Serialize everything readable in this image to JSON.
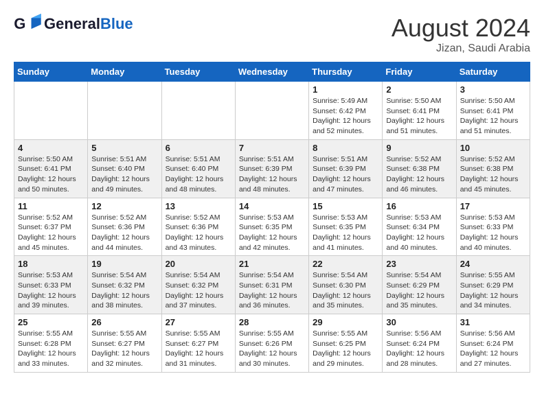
{
  "header": {
    "logo_general": "General",
    "logo_blue": "Blue",
    "month": "August 2024",
    "location": "Jizan, Saudi Arabia"
  },
  "days_of_week": [
    "Sunday",
    "Monday",
    "Tuesday",
    "Wednesday",
    "Thursday",
    "Friday",
    "Saturday"
  ],
  "weeks": [
    [
      {
        "day": "",
        "info": ""
      },
      {
        "day": "",
        "info": ""
      },
      {
        "day": "",
        "info": ""
      },
      {
        "day": "",
        "info": ""
      },
      {
        "day": "1",
        "info": "Sunrise: 5:49 AM\nSunset: 6:42 PM\nDaylight: 12 hours\nand 52 minutes."
      },
      {
        "day": "2",
        "info": "Sunrise: 5:50 AM\nSunset: 6:41 PM\nDaylight: 12 hours\nand 51 minutes."
      },
      {
        "day": "3",
        "info": "Sunrise: 5:50 AM\nSunset: 6:41 PM\nDaylight: 12 hours\nand 51 minutes."
      }
    ],
    [
      {
        "day": "4",
        "info": "Sunrise: 5:50 AM\nSunset: 6:41 PM\nDaylight: 12 hours\nand 50 minutes."
      },
      {
        "day": "5",
        "info": "Sunrise: 5:51 AM\nSunset: 6:40 PM\nDaylight: 12 hours\nand 49 minutes."
      },
      {
        "day": "6",
        "info": "Sunrise: 5:51 AM\nSunset: 6:40 PM\nDaylight: 12 hours\nand 48 minutes."
      },
      {
        "day": "7",
        "info": "Sunrise: 5:51 AM\nSunset: 6:39 PM\nDaylight: 12 hours\nand 48 minutes."
      },
      {
        "day": "8",
        "info": "Sunrise: 5:51 AM\nSunset: 6:39 PM\nDaylight: 12 hours\nand 47 minutes."
      },
      {
        "day": "9",
        "info": "Sunrise: 5:52 AM\nSunset: 6:38 PM\nDaylight: 12 hours\nand 46 minutes."
      },
      {
        "day": "10",
        "info": "Sunrise: 5:52 AM\nSunset: 6:38 PM\nDaylight: 12 hours\nand 45 minutes."
      }
    ],
    [
      {
        "day": "11",
        "info": "Sunrise: 5:52 AM\nSunset: 6:37 PM\nDaylight: 12 hours\nand 45 minutes."
      },
      {
        "day": "12",
        "info": "Sunrise: 5:52 AM\nSunset: 6:36 PM\nDaylight: 12 hours\nand 44 minutes."
      },
      {
        "day": "13",
        "info": "Sunrise: 5:52 AM\nSunset: 6:36 PM\nDaylight: 12 hours\nand 43 minutes."
      },
      {
        "day": "14",
        "info": "Sunrise: 5:53 AM\nSunset: 6:35 PM\nDaylight: 12 hours\nand 42 minutes."
      },
      {
        "day": "15",
        "info": "Sunrise: 5:53 AM\nSunset: 6:35 PM\nDaylight: 12 hours\nand 41 minutes."
      },
      {
        "day": "16",
        "info": "Sunrise: 5:53 AM\nSunset: 6:34 PM\nDaylight: 12 hours\nand 40 minutes."
      },
      {
        "day": "17",
        "info": "Sunrise: 5:53 AM\nSunset: 6:33 PM\nDaylight: 12 hours\nand 40 minutes."
      }
    ],
    [
      {
        "day": "18",
        "info": "Sunrise: 5:53 AM\nSunset: 6:33 PM\nDaylight: 12 hours\nand 39 minutes."
      },
      {
        "day": "19",
        "info": "Sunrise: 5:54 AM\nSunset: 6:32 PM\nDaylight: 12 hours\nand 38 minutes."
      },
      {
        "day": "20",
        "info": "Sunrise: 5:54 AM\nSunset: 6:32 PM\nDaylight: 12 hours\nand 37 minutes."
      },
      {
        "day": "21",
        "info": "Sunrise: 5:54 AM\nSunset: 6:31 PM\nDaylight: 12 hours\nand 36 minutes."
      },
      {
        "day": "22",
        "info": "Sunrise: 5:54 AM\nSunset: 6:30 PM\nDaylight: 12 hours\nand 35 minutes."
      },
      {
        "day": "23",
        "info": "Sunrise: 5:54 AM\nSunset: 6:29 PM\nDaylight: 12 hours\nand 35 minutes."
      },
      {
        "day": "24",
        "info": "Sunrise: 5:55 AM\nSunset: 6:29 PM\nDaylight: 12 hours\nand 34 minutes."
      }
    ],
    [
      {
        "day": "25",
        "info": "Sunrise: 5:55 AM\nSunset: 6:28 PM\nDaylight: 12 hours\nand 33 minutes."
      },
      {
        "day": "26",
        "info": "Sunrise: 5:55 AM\nSunset: 6:27 PM\nDaylight: 12 hours\nand 32 minutes."
      },
      {
        "day": "27",
        "info": "Sunrise: 5:55 AM\nSunset: 6:27 PM\nDaylight: 12 hours\nand 31 minutes."
      },
      {
        "day": "28",
        "info": "Sunrise: 5:55 AM\nSunset: 6:26 PM\nDaylight: 12 hours\nand 30 minutes."
      },
      {
        "day": "29",
        "info": "Sunrise: 5:55 AM\nSunset: 6:25 PM\nDaylight: 12 hours\nand 29 minutes."
      },
      {
        "day": "30",
        "info": "Sunrise: 5:56 AM\nSunset: 6:24 PM\nDaylight: 12 hours\nand 28 minutes."
      },
      {
        "day": "31",
        "info": "Sunrise: 5:56 AM\nSunset: 6:24 PM\nDaylight: 12 hours\nand 27 minutes."
      }
    ]
  ]
}
